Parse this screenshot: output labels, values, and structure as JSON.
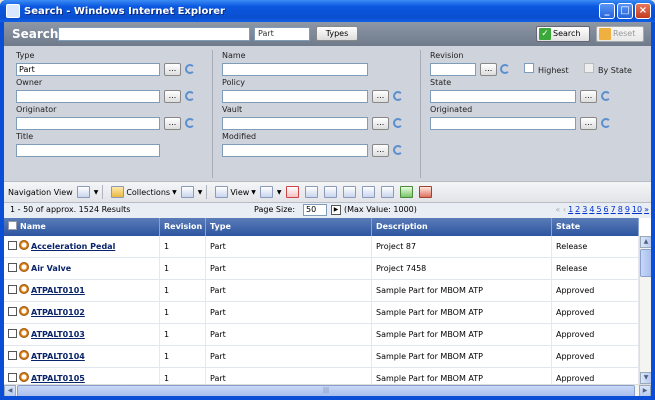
{
  "window": {
    "title": "Search - Windows Internet Explorer",
    "controls": [
      "_",
      "□",
      "×"
    ]
  },
  "search_bar": {
    "title": "Search",
    "query_value": "",
    "type_value": "Part",
    "types_label": "Types",
    "search_label": "Search",
    "reset_label": "Reset"
  },
  "filters": {
    "type": {
      "label": "Type",
      "value": "Part"
    },
    "owner": {
      "label": "Owner",
      "value": ""
    },
    "originator": {
      "label": "Originator",
      "value": ""
    },
    "title": {
      "label": "Title",
      "value": ""
    },
    "name": {
      "label": "Name",
      "value": ""
    },
    "policy": {
      "label": "Policy",
      "value": ""
    },
    "vault": {
      "label": "Vault",
      "value": ""
    },
    "modified": {
      "label": "Modified",
      "value": ""
    },
    "revision": {
      "label": "Revision",
      "value": ""
    },
    "highest_label": "Highest",
    "by_state_label": "By State",
    "state": {
      "label": "State",
      "value": ""
    },
    "originated": {
      "label": "Originated",
      "value": ""
    },
    "ellipsis": "..."
  },
  "toolbar": {
    "navigation_view": "Navigation View",
    "collections": "Collections",
    "view": "View"
  },
  "pager": {
    "results_text": "1 - 50 of approx. 1524 Results",
    "page_size_label": "Page Size:",
    "page_size_value": "50",
    "max_value_text": "(Max Value: 1000)",
    "prev_arrows": "« ‹",
    "pages": [
      "1",
      "2",
      "3",
      "4",
      "5",
      "6",
      "7",
      "8",
      "9",
      "10"
    ],
    "next_arrow": "»"
  },
  "grid": {
    "columns": [
      "Name",
      "Revision",
      "Type",
      "Description",
      "State"
    ],
    "rows": [
      {
        "name": "Acceleration Pedal",
        "revision": "1",
        "type": "Part",
        "description": "Project 87",
        "state": "Release"
      },
      {
        "name": "Air Valve",
        "revision": "1",
        "type": "Part",
        "description": "Project 7458",
        "state": "Release"
      },
      {
        "name": "ATPALT0101",
        "revision": "1",
        "type": "Part",
        "description": "Sample Part for MBOM ATP",
        "state": "Approved"
      },
      {
        "name": "ATPALT0102",
        "revision": "1",
        "type": "Part",
        "description": "Sample Part for MBOM ATP",
        "state": "Approved"
      },
      {
        "name": "ATPALT0103",
        "revision": "1",
        "type": "Part",
        "description": "Sample Part for MBOM ATP",
        "state": "Approved"
      },
      {
        "name": "ATPALT0104",
        "revision": "1",
        "type": "Part",
        "description": "Sample Part for MBOM ATP",
        "state": "Approved"
      },
      {
        "name": "ATPALT0105",
        "revision": "1",
        "type": "Part",
        "description": "Sample Part for MBOM ATP",
        "state": "Approved"
      }
    ]
  },
  "scrollbars": {
    "up": "▲",
    "down": "▼",
    "left": "◀",
    "right": "▶",
    "grip": "|||"
  },
  "colors": {
    "titlebar": "#0a4ed8",
    "search_header": "#7a8596",
    "filter_panel": "#cfd3db",
    "grid_header": "#3d63a8",
    "link": "#0a246a"
  }
}
